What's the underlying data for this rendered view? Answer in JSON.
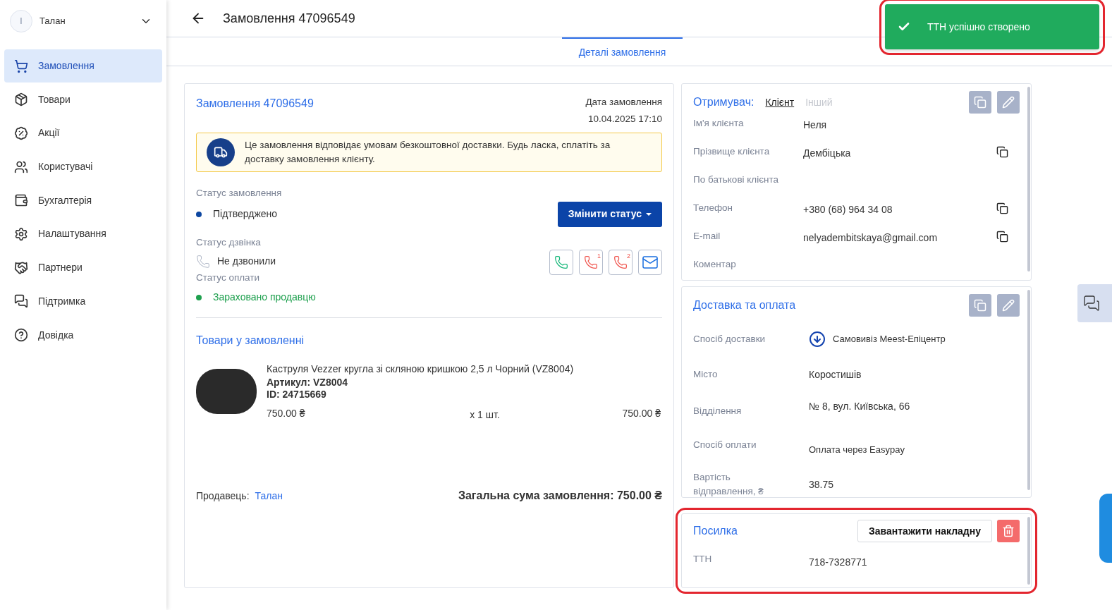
{
  "account": {
    "initial": "I",
    "name": "Талан"
  },
  "sidebar": {
    "items": [
      {
        "label": "Замовлення",
        "selected": true
      },
      {
        "label": "Товари",
        "selected": false
      },
      {
        "label": "Акції",
        "selected": false
      },
      {
        "label": "Користувачі",
        "selected": false
      },
      {
        "label": "Бухгалтерія",
        "selected": false
      },
      {
        "label": "Налаштування",
        "selected": false
      },
      {
        "label": "Партнери",
        "selected": false
      },
      {
        "label": "Підтримка",
        "selected": false
      },
      {
        "label": "Довідка",
        "selected": false
      }
    ]
  },
  "header": {
    "title": "Замовлення 47096549"
  },
  "tabs": [
    {
      "label": "Деталі замовлення",
      "selected": true
    }
  ],
  "toast": {
    "message": "ТТН успішно створено",
    "highlighted": true
  },
  "order": {
    "title": "Замовлення 47096549",
    "date_label": "Дата замовлення",
    "date": "10.04.2025 17:10",
    "notice": "Це замовлення відповідає умовам безкоштовної доставки. Будь ласка, сплатіть за доставку замовлення клієнту.",
    "order_status": {
      "label": "Статус замовлення",
      "value": "Підтверджено",
      "color": "#0d47a1"
    },
    "change_status_button": "Змінити статус",
    "call_status": {
      "label": "Статус дзвінка",
      "value": "Не дзвонили"
    },
    "call_actions": [
      {
        "kind": "call"
      },
      {
        "kind": "missed",
        "number": "1"
      },
      {
        "kind": "missed",
        "number": "2"
      },
      {
        "kind": "email"
      }
    ],
    "payment_status": {
      "label": "Статус оплати",
      "value": "Зараховано продавцю",
      "color": "#1ea04e"
    },
    "products_title": "Товари у замовленні",
    "products": [
      {
        "name": "Каструля Vezzer кругла зі скляною кришкою 2,5 л Чорний (VZ8004)",
        "sku": "Артикул: VZ8004",
        "id": "ID: 24715669",
        "price": "750.00 ₴",
        "quantity": "x 1 шт.",
        "total": "750.00 ₴"
      }
    ],
    "seller_label": "Продавець:",
    "seller": "Талан",
    "grand_total": "Загальна сума замовлення: 750.00 ₴"
  },
  "recipient": {
    "title": "Отримувач:",
    "options": [
      {
        "label": "Клієнт",
        "selected": true
      },
      {
        "label": "Інший",
        "selected": false
      }
    ],
    "fields": [
      {
        "label": "Ім'я клієнта",
        "value": "Неля",
        "copyable": false
      },
      {
        "label": "Прізвище клієнта",
        "value": "Дембіцька",
        "copyable": true
      },
      {
        "label": "По батькові клієнта",
        "copyable": false
      },
      {
        "label": "Телефон",
        "value": "+380 (68) 964 34 08",
        "copyable": true
      },
      {
        "label": "E-mail",
        "value": "nelyadembitskaya@gmail.com",
        "copyable": true
      },
      {
        "label": "Коментар",
        "copyable": false
      }
    ]
  },
  "delivery": {
    "title": "Доставка та оплата",
    "fields": [
      {
        "label": "Спосіб доставки",
        "value": "Самовивіз Meest-Епіцентр",
        "kind": "carrier"
      },
      {
        "label": "Місто",
        "value": "Коростишів",
        "kind": "text"
      },
      {
        "label": "Відділення",
        "value": "№ 8, вул. Київська, 66",
        "kind": "text"
      },
      {
        "label": "Спосіб оплати",
        "value": "Оплата через Easypay",
        "kind": "small"
      },
      {
        "label": "Вартість відправлення, ₴",
        "value": "38.75",
        "kind": "text"
      }
    ]
  },
  "parcel": {
    "title": "Посилка",
    "download_button": "Завантажити накладну",
    "highlighted": true,
    "fields": [
      {
        "label": "ТТН",
        "value": "718-7328771"
      }
    ]
  }
}
